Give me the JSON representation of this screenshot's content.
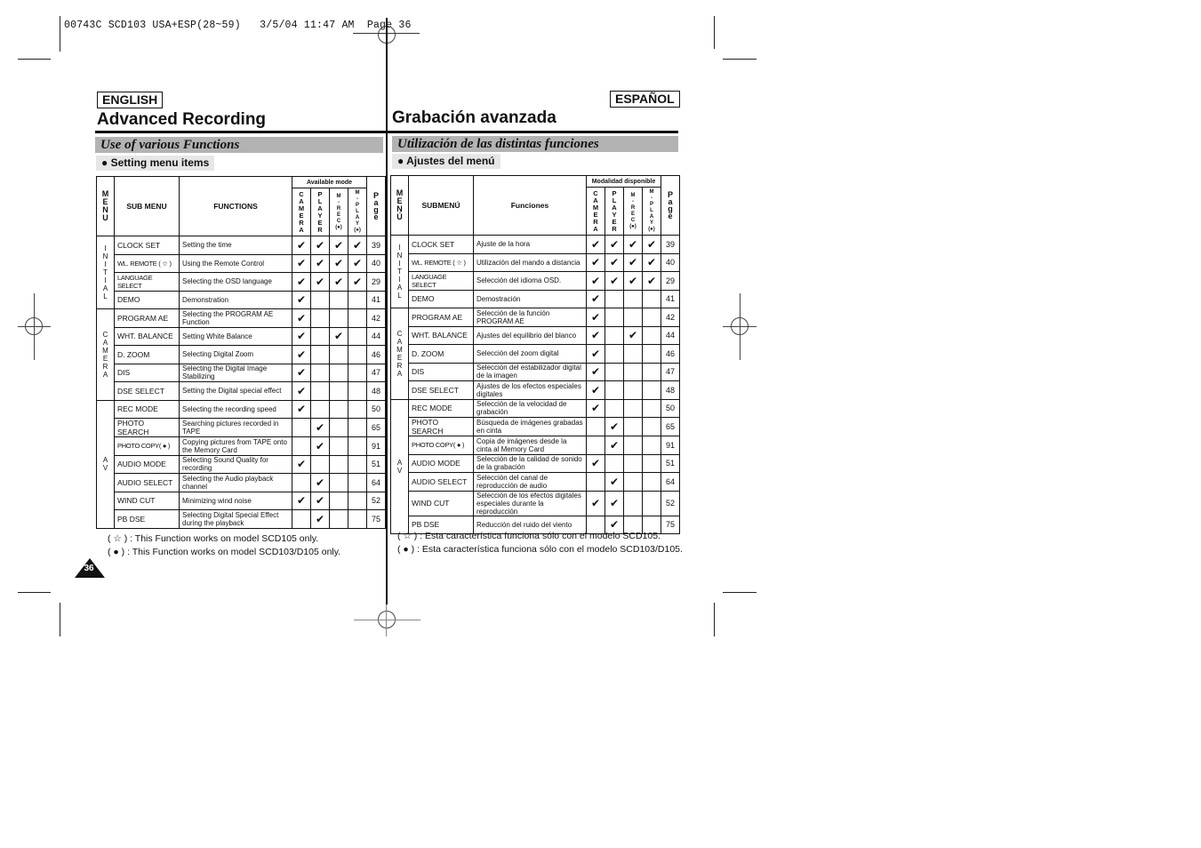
{
  "print_slug": "00743C SCD103 USA+ESP(28~59)   3/5/04 11:47 AM  Page 36",
  "page_number": "36",
  "english": {
    "lang_badge": "ENGLISH",
    "title": "Advanced Recording",
    "section": "Use of various Functions",
    "subsection": "● Setting menu items",
    "table": {
      "headers": {
        "menu": [
          "M",
          "E",
          "N",
          "U"
        ],
        "submenu": "SUB MENU",
        "functions": "FUNCTIONS",
        "available_mode": "Available mode",
        "modes": [
          [
            "C",
            "A",
            "M",
            "E",
            "R",
            "A"
          ],
          [
            "P",
            "L",
            "A",
            "Y",
            "E",
            "R"
          ],
          [
            "M",
            "-",
            "R",
            "E",
            "C",
            "(●)"
          ],
          [
            "M",
            "-",
            "P",
            "L",
            "A",
            "Y",
            "(●)"
          ]
        ],
        "page": [
          "P",
          "a",
          "g",
          "e"
        ]
      },
      "groups": [
        {
          "label": [
            "I",
            "N",
            "I",
            "T",
            "I",
            "A",
            "L"
          ],
          "rows": [
            {
              "submenu": "CLOCK SET",
              "function": "Setting the time",
              "modes": [
                "✔",
                "✔",
                "✔",
                "✔"
              ],
              "page": "39"
            },
            {
              "submenu": "WL. REMOTE ( ☆ )",
              "function": "Using the Remote Control",
              "modes": [
                "✔",
                "✔",
                "✔",
                "✔"
              ],
              "page": "40"
            },
            {
              "submenu": "LANGUAGE SELECT",
              "function": "Selecting the OSD language",
              "modes": [
                "✔",
                "✔",
                "✔",
                "✔"
              ],
              "page": "29"
            },
            {
              "submenu": "DEMO",
              "function": "Demonstration",
              "modes": [
                "✔",
                "",
                "",
                ""
              ],
              "page": "41"
            }
          ]
        },
        {
          "label": [
            "C",
            "A",
            "M",
            "E",
            "R",
            "A"
          ],
          "rows": [
            {
              "submenu": "PROGRAM AE",
              "function": "Selecting the PROGRAM AE Function",
              "modes": [
                "✔",
                "",
                "",
                ""
              ],
              "page": "42"
            },
            {
              "submenu": "WHT. BALANCE",
              "function": "Setting White Balance",
              "modes": [
                "✔",
                "",
                "✔",
                ""
              ],
              "page": "44"
            },
            {
              "submenu": "D. ZOOM",
              "function": "Selecting Digital Zoom",
              "modes": [
                "✔",
                "",
                "",
                ""
              ],
              "page": "46"
            },
            {
              "submenu": "DIS",
              "function": "Selecting the Digital Image Stabilizing",
              "modes": [
                "✔",
                "",
                "",
                ""
              ],
              "page": "47"
            },
            {
              "submenu": "DSE SELECT",
              "function": "Setting the Digital special effect",
              "modes": [
                "✔",
                "",
                "",
                ""
              ],
              "page": "48"
            }
          ]
        },
        {
          "label": [
            "A",
            "V"
          ],
          "rows": [
            {
              "submenu": "REC MODE",
              "function": "Selecting the recording speed",
              "modes": [
                "✔",
                "",
                "",
                ""
              ],
              "page": "50"
            },
            {
              "submenu": "PHOTO SEARCH",
              "function": "Searching pictures recorded in TAPE",
              "modes": [
                "",
                "✔",
                "",
                ""
              ],
              "page": "65"
            },
            {
              "submenu": "PHOTO COPY( ● )",
              "function": "Copying pictures from TAPE onto the Memory Card",
              "modes": [
                "",
                "✔",
                "",
                ""
              ],
              "page": "91"
            },
            {
              "submenu": "AUDIO MODE",
              "function": "Selecting Sound Quality for recording",
              "modes": [
                "✔",
                "",
                "",
                ""
              ],
              "page": "51"
            },
            {
              "submenu": "AUDIO SELECT",
              "function": "Selecting the Audio playback channel",
              "modes": [
                "",
                "✔",
                "",
                ""
              ],
              "page": "64"
            },
            {
              "submenu": "WIND CUT",
              "function": "Minimizing wind noise",
              "modes": [
                "✔",
                "✔",
                "",
                ""
              ],
              "page": "52"
            },
            {
              "submenu": "PB DSE",
              "function": "Selecting Digital Special Effect during the playback",
              "modes": [
                "",
                "✔",
                "",
                ""
              ],
              "page": "75"
            }
          ]
        }
      ]
    },
    "notes": [
      "( ☆ ) : This Function works on model SCD105 only.",
      "( ● ) : This Function works on model SCD103/D105 only."
    ]
  },
  "spanish": {
    "lang_badge": "ESPAÑOL",
    "title": "Grabación avanzada",
    "section": "Utilización de las distintas funciones",
    "subsection": "● Ajustes del menú",
    "table": {
      "headers": {
        "menu": [
          "M",
          "E",
          "N",
          "Ú"
        ],
        "submenu": "SUBMENÚ",
        "functions": "Funciones",
        "available_mode": "Modalidad disponible",
        "modes": [
          [
            "C",
            "A",
            "M",
            "E",
            "R",
            "A"
          ],
          [
            "P",
            "L",
            "A",
            "Y",
            "E",
            "R"
          ],
          [
            "M",
            "-",
            "R",
            "E",
            "C",
            "(●)"
          ],
          [
            "M",
            "-",
            "P",
            "L",
            "A",
            "Y",
            "(●)"
          ]
        ],
        "page": [
          "P",
          "a",
          "g",
          "e"
        ]
      },
      "groups": [
        {
          "label": [
            "I",
            "N",
            "I",
            "T",
            "I",
            "A",
            "L"
          ],
          "rows": [
            {
              "submenu": "CLOCK SET",
              "function": "Ajuste de la hora",
              "modes": [
                "✔",
                "✔",
                "✔",
                "✔"
              ],
              "page": "39"
            },
            {
              "submenu": "WL. REMOTE ( ☆ )",
              "function": "Utilización del mando a distancia",
              "modes": [
                "✔",
                "✔",
                "✔",
                "✔"
              ],
              "page": "40"
            },
            {
              "submenu": "LANGUAGE SELECT",
              "function": "Selección del idioma OSD.",
              "modes": [
                "✔",
                "✔",
                "✔",
                "✔"
              ],
              "page": "29"
            },
            {
              "submenu": "DEMO",
              "function": "Demostración",
              "modes": [
                "✔",
                "",
                "",
                ""
              ],
              "page": "41"
            }
          ]
        },
        {
          "label": [
            "C",
            "A",
            "M",
            "E",
            "R",
            "A"
          ],
          "rows": [
            {
              "submenu": "PROGRAM AE",
              "function": "Selección de la función PROGRAM AE",
              "modes": [
                "✔",
                "",
                "",
                ""
              ],
              "page": "42"
            },
            {
              "submenu": "WHT. BALANCE",
              "function": "Ajustes del equilibrio del blanco",
              "modes": [
                "✔",
                "",
                "✔",
                ""
              ],
              "page": "44"
            },
            {
              "submenu": "D. ZOOM",
              "function": "Selección del zoom digital",
              "modes": [
                "✔",
                "",
                "",
                ""
              ],
              "page": "46"
            },
            {
              "submenu": "DIS",
              "function": "Selección del estabilizador digital de la imagen",
              "modes": [
                "✔",
                "",
                "",
                ""
              ],
              "page": "47"
            },
            {
              "submenu": "DSE SELECT",
              "function": "Ajustes de los efectos especiales digitales",
              "modes": [
                "✔",
                "",
                "",
                ""
              ],
              "page": "48"
            }
          ]
        },
        {
          "label": [
            "A",
            "V"
          ],
          "rows": [
            {
              "submenu": "REC MODE",
              "function": "Selección de la velocidad de grabación",
              "modes": [
                "✔",
                "",
                "",
                ""
              ],
              "page": "50"
            },
            {
              "submenu": "PHOTO SEARCH",
              "function": "Búsqueda de imágenes grabadas en cinta",
              "modes": [
                "",
                "✔",
                "",
                ""
              ],
              "page": "65"
            },
            {
              "submenu": "PHOTO COPY( ● )",
              "function": "Copia de imágenes desde la cinta al Memory Card",
              "modes": [
                "",
                "✔",
                "",
                ""
              ],
              "page": "91"
            },
            {
              "submenu": "AUDIO MODE",
              "function": "Selección de la calidad de sonido de la grabación",
              "modes": [
                "✔",
                "",
                "",
                ""
              ],
              "page": "51"
            },
            {
              "submenu": "AUDIO SELECT",
              "function": "Selección del canal de reproducción de audio",
              "modes": [
                "",
                "✔",
                "",
                ""
              ],
              "page": "64"
            },
            {
              "submenu": "WIND CUT",
              "function": "Selección de los efectos digitales especiales durante la reproducción",
              "modes": [
                "✔",
                "✔",
                "",
                ""
              ],
              "page": "52"
            },
            {
              "submenu": "PB DSE",
              "function": "Reducción del ruido del viento",
              "modes": [
                "",
                "✔",
                "",
                ""
              ],
              "page": "75"
            }
          ]
        }
      ]
    },
    "notes": [
      "( ☆ ) : Esta característica funciona sólo con el modelo SCD105.",
      "( ● ) : Esta característica funciona sólo con el modelo SCD103/D105."
    ]
  }
}
